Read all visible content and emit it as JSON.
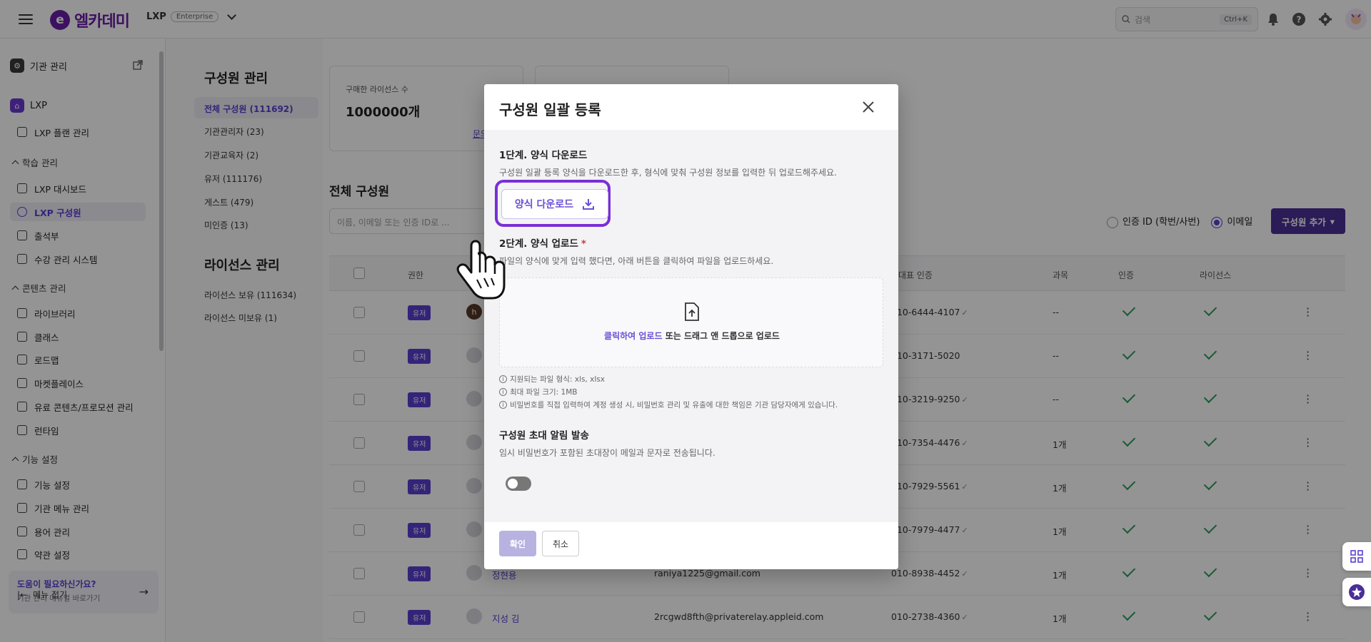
{
  "header": {
    "brand": "엘카데미",
    "brand_mark": "e",
    "product": "LXP",
    "edition": "Enterprise",
    "search_placeholder": "검색",
    "search_shortcut": "Ctrl+K",
    "icons": [
      "bell-icon",
      "help-icon",
      "gear-icon"
    ]
  },
  "sidebar": {
    "org_admin": "기관 관리",
    "lxp": "LXP",
    "plan": "LXP 플랜 관리",
    "sections": {
      "learning": "학습 관리",
      "content": "콘텐츠 관리",
      "features": "기능 설정"
    },
    "learning_items": [
      "LXP 대시보드",
      "LXP 구성원",
      "출석부",
      "수강 관리 시스템"
    ],
    "content_items": [
      "라이브러리",
      "클래스",
      "로드맵",
      "마켓플레이스",
      "유료 콘텐츠/프로모션 관리",
      "런타임"
    ],
    "feature_items": [
      "기능 설정",
      "기관 메뉴 관리",
      "용어 관리",
      "약관 설정"
    ],
    "help_title": "도움이 필요하신가요?",
    "help_sub": "기관 관리 매뉴얼 바로가기",
    "collapse": "메뉴 접기"
  },
  "subnav": {
    "members_title": "구성원 관리",
    "members": [
      "전체 구성원 (111692)",
      "기관관리자 (23)",
      "기관교육자 (2)",
      "유저 (111176)",
      "게스트 (479)",
      "미인증 (13)"
    ],
    "license_title": "라이선스 관리",
    "licenses": [
      "라이선스 보유 (111634)",
      "라이선스 미보유 (1)"
    ]
  },
  "main": {
    "licenses_label": "구매한 라이선스 수",
    "licenses_value": "1000000개",
    "card_link": "문의",
    "page_title": "전체 구성원",
    "filter_placeholder": "이름, 이메일 또는 인증 ID로 ...",
    "radio_id": "인증 ID (학번/사번)",
    "radio_email": "이메일",
    "add_button": "구성원 추가",
    "columns": [
      "권한",
      "대표 인증",
      "과목",
      "인증",
      "라이선스"
    ],
    "rows": [
      {
        "role": "유저",
        "avatar": "h",
        "name": "",
        "email": "",
        "phone": "010-6444-4107",
        "verified": true,
        "courses": "--"
      },
      {
        "role": "유저",
        "avatar": "",
        "name": "",
        "email": "",
        "phone": "010-3171-5020",
        "verified": false,
        "courses": "--"
      },
      {
        "role": "유저",
        "avatar": "",
        "name": "",
        "email": "",
        "phone": "010-3219-9250",
        "verified": true,
        "courses": "--"
      },
      {
        "role": "유저",
        "avatar": "",
        "name": "",
        "email": "",
        "phone": "010-7354-4476",
        "verified": true,
        "courses": "1개"
      },
      {
        "role": "유저",
        "avatar": "",
        "name": "",
        "email": "",
        "phone": "010-7929-5561",
        "verified": true,
        "courses": "1개"
      },
      {
        "role": "유저",
        "avatar": "",
        "name": "",
        "email": "",
        "phone": "010-7979-4477",
        "verified": true,
        "courses": "1개"
      },
      {
        "role": "유저",
        "avatar": "",
        "name": "정현용",
        "email": "raniya1225@gmail.com",
        "phone": "010-8938-4452",
        "verified": true,
        "courses": "1개"
      },
      {
        "role": "유저",
        "avatar": "",
        "name": "지성 김",
        "email": "2rcgwd8fth@privaterelay.appleid.com",
        "phone": "010-2738-4360",
        "verified": true,
        "courses": "1개"
      }
    ]
  },
  "modal": {
    "title": "구성원 일괄 등록",
    "step1_title": "1단계. 양식 다운로드",
    "step1_desc": "구성원 일괄 등록 양식을 다운로드한 후, 형식에 맞춰 구성원 정보를 입력한 뒤 업로드해주세요.",
    "download_button": "양식 다운로드",
    "step2_title": "2단계. 양식 업로드",
    "step2_required": "*",
    "step2_desc": "파일의 양식에 맞게 입력 했다면, 아래 버튼을 클릭하여 파일을 업로드하세요.",
    "upload_link": "클릭하여 업로드",
    "upload_rest": " 또는 드래그 앤 드롭으로 업로드",
    "note_formats": "지원되는 파일 형식: xls, xlsx",
    "note_size": "최대 파일 크기: 1MB",
    "note_password": "비밀번호를 직접 입력하여 계정 생성 시, 비밀번호 관리 및 유출에 대한 책임은 기관 담당자에게 있습니다.",
    "invite_title": "구성원 초대 알림 발송",
    "invite_desc": "임시 비밀번호가 포함된 초대장이 메일과 문자로 전송됩니다.",
    "invite_enabled": false,
    "confirm": "확인",
    "cancel": "취소"
  }
}
